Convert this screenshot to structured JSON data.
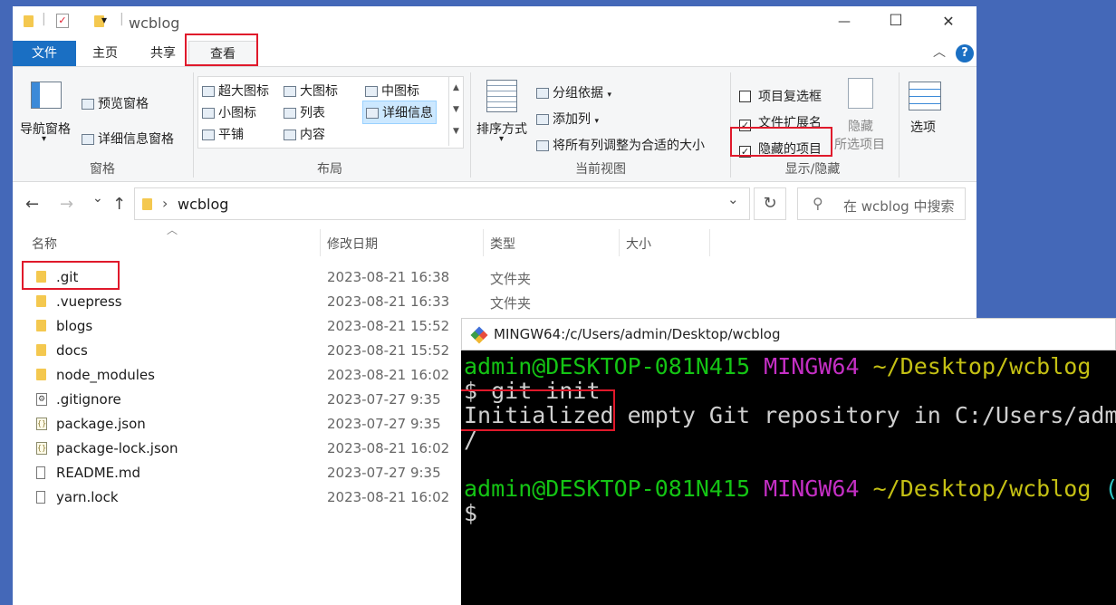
{
  "window": {
    "title": "wcblog",
    "quick_access_glyph": "▾",
    "minimize": "—",
    "maximize": "☐",
    "close": "✕"
  },
  "ribbon_tabs": [
    "文件",
    "主页",
    "共享",
    "查看"
  ],
  "ribbon_collapse_glyph": "︿",
  "help_glyph": "?",
  "ribbon": {
    "panes": {
      "label": "窗格",
      "nav_pane": "导航窗格",
      "nav_pane_arrow": "▾",
      "preview_pane": "预览窗格",
      "details_pane": "详细信息窗格"
    },
    "layout": {
      "label": "布局",
      "items": [
        "超大图标",
        "大图标",
        "中图标",
        "小图标",
        "列表",
        "详细信息",
        "平铺",
        "内容"
      ]
    },
    "current_view": {
      "label": "当前视图",
      "sort_by": "排序方式",
      "sort_arrow": "▾",
      "group_by": "分组依据",
      "add_columns": "添加列",
      "size_all_columns": "将所有列调整为合适的大小"
    },
    "show_hide": {
      "label": "显示/隐藏",
      "item_checkboxes": {
        "label": "项目复选框",
        "checked": false
      },
      "file_extensions": {
        "label": "文件扩展名",
        "checked": true
      },
      "hidden_items": {
        "label": "隐藏的项目",
        "checked": true
      },
      "hide_selected_line1": "隐藏",
      "hide_selected_line2": "所选项目",
      "check_glyph": "✓"
    },
    "options": "选项"
  },
  "address": {
    "back": "←",
    "forward": "→",
    "recent": "⌄",
    "up": "↑",
    "chevron": "›",
    "path": "wcblog",
    "dropdown": "⌄",
    "refresh": "↻",
    "search_placeholder": "在 wcblog 中搜索",
    "search_glyph": "⚲"
  },
  "columns": [
    "名称",
    "修改日期",
    "类型",
    "大小"
  ],
  "sort_glyph": "︿",
  "files": [
    {
      "name": ".git",
      "date": "2023-08-21 16:38",
      "type": "文件夹",
      "icon": "folder-icon"
    },
    {
      "name": ".vuepress",
      "date": "2023-08-21 16:33",
      "type": "文件夹",
      "icon": "folder-icon"
    },
    {
      "name": "blogs",
      "date": "2023-08-21 15:52",
      "type": "",
      "icon": "folder-icon"
    },
    {
      "name": "docs",
      "date": "2023-08-21 15:52",
      "type": "",
      "icon": "folder-icon"
    },
    {
      "name": "node_modules",
      "date": "2023-08-21 16:02",
      "type": "",
      "icon": "folder-icon"
    },
    {
      "name": ".gitignore",
      "date": "2023-07-27 9:35",
      "type": "",
      "icon": "settings-file-icon"
    },
    {
      "name": "package.json",
      "date": "2023-07-27 9:35",
      "type": "",
      "icon": "json-file-icon"
    },
    {
      "name": "package-lock.json",
      "date": "2023-08-21 16:02",
      "type": "",
      "icon": "json-file-icon"
    },
    {
      "name": "README.md",
      "date": "2023-07-27 9:35",
      "type": "",
      "icon": "file-icon"
    },
    {
      "name": "yarn.lock",
      "date": "2023-08-21 16:02",
      "type": "",
      "icon": "file-icon"
    }
  ],
  "terminal": {
    "title": "MINGW64:/c/Users/admin/Desktop/wcblog",
    "user_host": "admin@DESKTOP-081N415",
    "shell": "MINGW64",
    "cwd": "~/Desktop/wcblog",
    "branch_open": "(",
    "command": "$ git init",
    "output_line1": "Initialized empty Git repository in C:/Users/adm",
    "output_line2": "/",
    "prompt": "$"
  },
  "colors": {
    "file_tab": "#1a6fc3",
    "highlight": "#e0192b",
    "term_green": "#14c414",
    "term_magenta": "#c42fc4",
    "term_yellow": "#c4c014"
  }
}
